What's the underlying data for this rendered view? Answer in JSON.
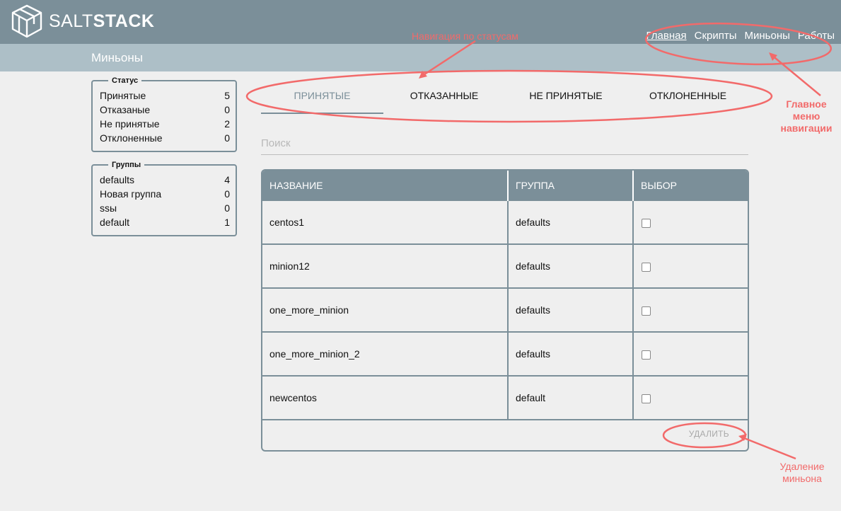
{
  "brand": {
    "part1": "SALT",
    "part2": "STACK"
  },
  "main_nav": [
    "Главная",
    "Скрипты",
    "Миньоны",
    "Работы"
  ],
  "page_title": "Миньоны",
  "status_panel": {
    "title": "Статус",
    "rows": [
      {
        "label": "Принятые",
        "count": "5"
      },
      {
        "label": "Отказаные",
        "count": "0"
      },
      {
        "label": "Не принятые",
        "count": "2"
      },
      {
        "label": "Отклоненные",
        "count": "0"
      }
    ]
  },
  "groups_panel": {
    "title": "Группы",
    "rows": [
      {
        "label": "defaults",
        "count": "4"
      },
      {
        "label": "Новая группа",
        "count": "0"
      },
      {
        "label": "ssы",
        "count": "0"
      },
      {
        "label": "default",
        "count": "1"
      }
    ]
  },
  "tabs": [
    "ПРИНЯТЫЕ",
    "ОТКАЗАННЫЕ",
    "НЕ ПРИНЯТЫЕ",
    "ОТКЛОНЕННЫЕ"
  ],
  "search": {
    "placeholder": "Поиск"
  },
  "table": {
    "headers": [
      "НАЗВАНИЕ",
      "ГРУППА",
      "ВЫБОР"
    ],
    "rows": [
      {
        "name": "centos1",
        "group": "defaults"
      },
      {
        "name": "minion12",
        "group": "defaults"
      },
      {
        "name": "one_more_minion",
        "group": "defaults"
      },
      {
        "name": "one_more_minion_2",
        "group": "defaults"
      },
      {
        "name": "newcentos",
        "group": "default"
      }
    ],
    "delete_label": "УДАЛИТЬ"
  },
  "annotations": {
    "status_nav": "Навигация по статусам",
    "main_menu": [
      "Главное",
      "меню",
      "навигации"
    ],
    "delete": [
      "Удаление",
      "миньона"
    ]
  },
  "colors": {
    "topbar": "#7b8f99",
    "subbar": "#adbfc7",
    "background": "#efefef",
    "annotation": "#f26a6a"
  }
}
